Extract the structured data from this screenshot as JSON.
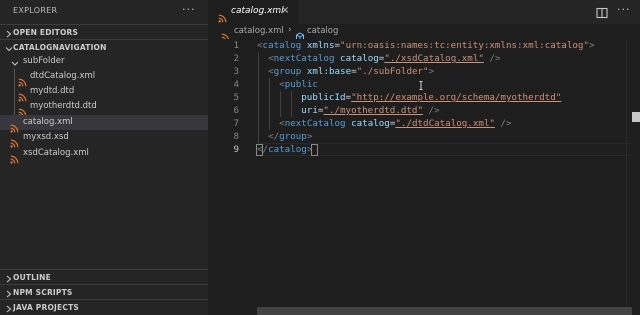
{
  "explorer": {
    "title": "EXPLORER",
    "more": "···",
    "open_editors": "OPEN EDITORS",
    "root": "CATALOGNAVIGATION",
    "tree": [
      {
        "name": "subFolder",
        "type": "folder"
      },
      {
        "name": "dtdCatalog.xml",
        "type": "file"
      },
      {
        "name": "mydtd.dtd",
        "type": "file"
      },
      {
        "name": "myotherdtd.dtd",
        "type": "file"
      },
      {
        "name": "catalog.xml",
        "type": "file",
        "selected": true
      },
      {
        "name": "myxsd.xsd",
        "type": "file"
      },
      {
        "name": "xsdCatalog.xml",
        "type": "file"
      }
    ],
    "sections": [
      "OUTLINE",
      "NPM SCRIPTS",
      "JAVA PROJECTS"
    ]
  },
  "tabs": [
    {
      "label": "catalog.xml",
      "close": "×",
      "active": true
    }
  ],
  "tab_actions": {
    "more": "···"
  },
  "breadcrumb": {
    "file": "catalog.xml",
    "separator": "›",
    "element": "catalog"
  },
  "editor": {
    "line_numbers": [
      "1",
      "2",
      "3",
      "4",
      "5",
      "6",
      "7",
      "8",
      "9"
    ],
    "current_line": 9,
    "lines": [
      {
        "indent": "",
        "t1": "<",
        "name": "catalog",
        "a1": "xmlns",
        "eq1": "=",
        "v1": "\"urn:oasis:names:tc:entity:xmlns:xml:catalog\"",
        "end": ">"
      },
      {
        "indent": "  ",
        "t1": "<",
        "name": "nextCatalog",
        "a1": "catalog",
        "eq1": "=",
        "v1": "\"./xsdCatalog.xml\"",
        "end": " />"
      },
      {
        "indent": "  ",
        "t1": "<",
        "name": "group",
        "a1": "xml:base",
        "eq1": "=",
        "v1": "\"./subFolder\"",
        "end": ">"
      },
      {
        "indent": "    ",
        "t1": "<",
        "name": "public",
        "end": ""
      },
      {
        "indent": "        ",
        "a1": "publicId",
        "eq1": "=",
        "v1": "\"http://example.org/schema/myotherdtd\""
      },
      {
        "indent": "        ",
        "a1": "uri",
        "eq1": "=",
        "v1": "\"./myotherdtd.dtd\"",
        "end": " />"
      },
      {
        "indent": "    ",
        "t1": "<",
        "name": "nextCatalog",
        "a1": "catalog",
        "eq1": "=",
        "v1": "\"./dtdCatalog.xml\"",
        "end": " />"
      },
      {
        "indent": "  ",
        "t1": "</",
        "name": "group",
        "end": ">"
      },
      {
        "indent": "",
        "t1": "</",
        "name": "catalog",
        "end": ">"
      }
    ]
  },
  "colors": {
    "tag": "#808080",
    "element": "#569cd6",
    "attribute": "#9cdcfe",
    "value": "#ce9178",
    "xml_icon": "#e37933",
    "symbol_icon": "#75beff"
  },
  "icons": {
    "file": "rss-icon",
    "breadcrumb_symbol": "element-symbol-icon",
    "split": "split-editor-icon"
  }
}
